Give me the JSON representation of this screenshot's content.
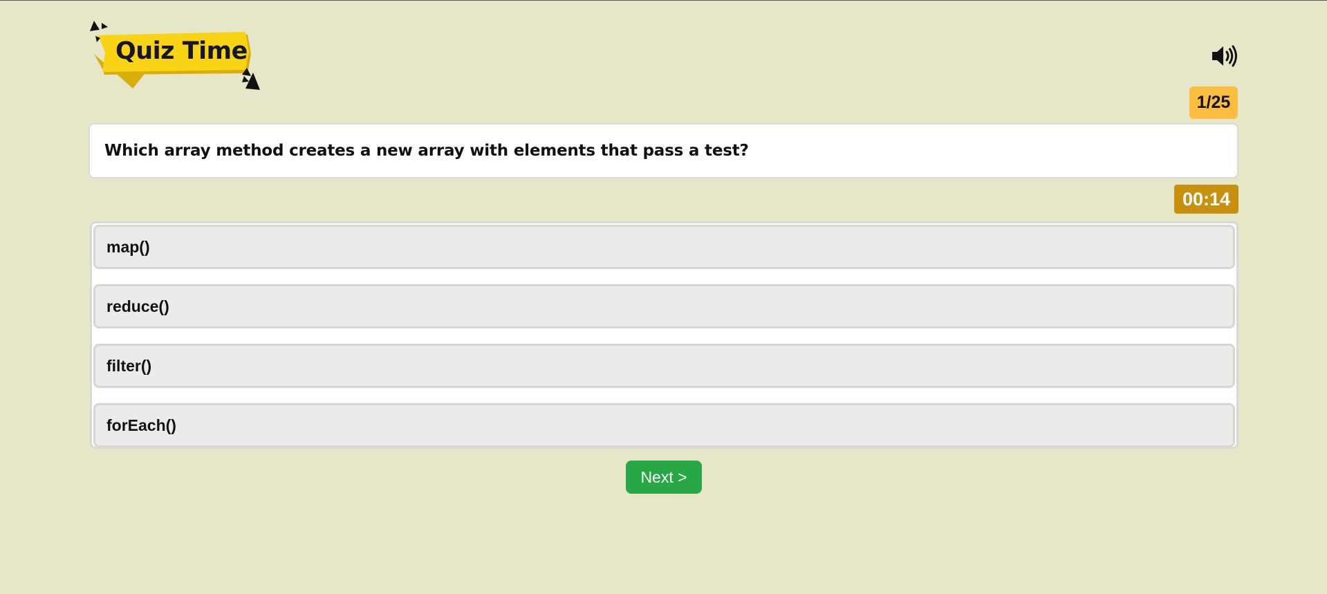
{
  "logo": {
    "text": "Quiz Time",
    "icon": "quiz-time-logo",
    "colors": {
      "banner": "#f9d415",
      "banner_shadow": "#d9ae0a",
      "text": "#15152e"
    }
  },
  "sound": {
    "icon": "speaker-volume-icon"
  },
  "progress": {
    "label": "1/25",
    "current": 1,
    "total": 25
  },
  "question": {
    "text": "Which array method creates a new array with elements that pass a test?"
  },
  "timer": {
    "label": "00:14"
  },
  "options": [
    {
      "label": "map()"
    },
    {
      "label": "reduce()"
    },
    {
      "label": "filter()"
    },
    {
      "label": "forEach()"
    }
  ],
  "next_button": {
    "label": "Next >"
  },
  "colors": {
    "background": "#e6e7c8",
    "counter": "#fbbe40",
    "timer": "#c9900e",
    "next_button": "#28a745",
    "option_bg": "#edebe9"
  }
}
